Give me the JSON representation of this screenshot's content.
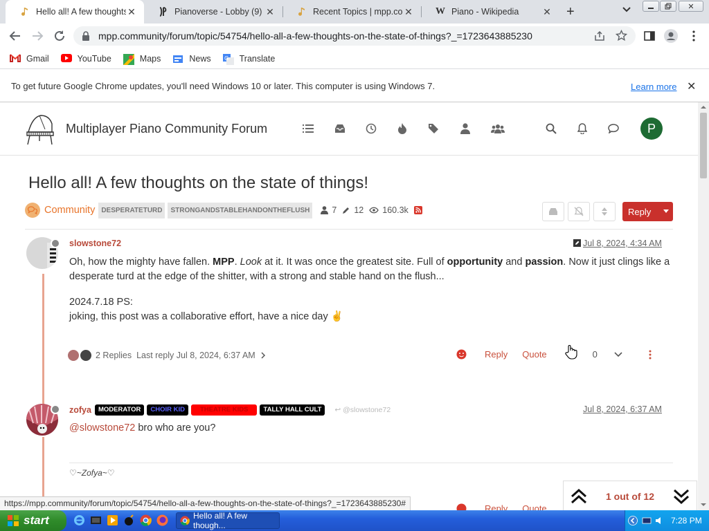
{
  "browser": {
    "tabs": [
      {
        "title": "Hello all! A few thoughts",
        "active": true
      },
      {
        "title": "Pianoverse - Lobby (9)",
        "active": false
      },
      {
        "title": "Recent Topics | mpp.comm",
        "active": false
      },
      {
        "title": "Piano - Wikipedia",
        "active": false
      }
    ],
    "url": "mpp.community/forum/topic/54754/hello-all-a-few-thoughts-on-the-state-of-things?_=1723643885230",
    "bookmarks": [
      "Gmail",
      "YouTube",
      "Maps",
      "News",
      "Translate"
    ],
    "infobar": {
      "message": "To get future Google Chrome updates, you'll need Windows 10 or later. This computer is using Windows 7.",
      "learn_more": "Learn more"
    },
    "status_url": "https://mpp.community/forum/topic/54754/hello-all-a-few-thoughts-on-the-state-of-things?_=1723643885230#"
  },
  "forum": {
    "brand": "Multiplayer Piano Community Forum",
    "user_initial": "P",
    "nav_icons": [
      "list-icon",
      "inbox-icon",
      "clock-icon",
      "fire-icon",
      "tags-icon",
      "user-icon",
      "users-icon"
    ],
    "topic": {
      "title": "Hello all! A few thoughts on the state of things!",
      "category": "Community",
      "tags": [
        "DESPERATETURD",
        "STRONGANDSTABLEHANDONTHEFLUSH"
      ],
      "posters": "7",
      "posts": "12",
      "views": "160.3k",
      "reply_label": "Reply"
    },
    "posts": [
      {
        "username": "slowstone72",
        "time": "Jul 8, 2024, 4:34 AM",
        "p1_a": "Oh, how the mighty have fallen. ",
        "p1_b": "MPP",
        "p1_c": ". ",
        "p1_d": "Look",
        "p1_e": " at it. It was once the greatest site. Full of ",
        "p1_f": "opportunity",
        "p1_g": " and ",
        "p1_h": "passion",
        "p1_i": ". Now it just clings like a desperate turd at the edge of the shitter, with a strong and stable hand on the flush...",
        "p2": "2024.7.18 PS:",
        "p3": "joking, this post was a collaborative effort, have a nice day ✌️",
        "replies": "2 Replies",
        "last_reply": "Last reply Jul 8, 2024, 6:37 AM",
        "reply": "Reply",
        "quote": "Quote",
        "votes": "0"
      },
      {
        "username": "zofya",
        "badges": [
          {
            "label": "MODERATOR",
            "bg": "#000000",
            "fg": "#ffffff"
          },
          {
            "label": "CHOIR KID",
            "bg": "#000000",
            "fg": "#5b62ff"
          },
          {
            "label": "THEATRE KIDS",
            "bg": "#ff0000",
            "fg": "#c40000"
          },
          {
            "label": "TALLY HALL CULT",
            "bg": "#000000",
            "fg": "#ffffff"
          }
        ],
        "reply_to": "@slowstone72",
        "time": "Jul 8, 2024, 6:37 AM",
        "mention": "@slowstone72",
        "text": " bro who are you?",
        "signature": "♡~Zofya~♡",
        "reply": "Reply",
        "quote": "Quote"
      }
    ],
    "pagination": "1 out of 12"
  },
  "taskbar": {
    "start": "start",
    "app": "Hello all! A few though...",
    "clock": "7:28 PM"
  }
}
